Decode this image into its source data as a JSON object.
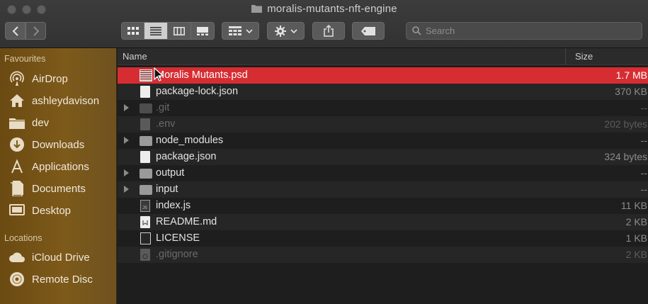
{
  "window": {
    "title": "moralis-mutants-nft-engine"
  },
  "toolbar": {
    "search_placeholder": "Search",
    "icons": [
      "chevron-left-icon",
      "chevron-right-icon",
      "icon-view-icon",
      "list-view-icon",
      "column-view-icon",
      "gallery-view-icon",
      "group-icon",
      "gear-icon",
      "share-icon",
      "tag-icon",
      "search-icon"
    ]
  },
  "sidebar": {
    "favourites_heading": "Favourites",
    "favourites": [
      {
        "label": "AirDrop",
        "icon": "airdrop-icon"
      },
      {
        "label": "ashleydavison",
        "icon": "home-icon"
      },
      {
        "label": "dev",
        "icon": "folder-icon"
      },
      {
        "label": "Downloads",
        "icon": "downloads-icon"
      },
      {
        "label": "Applications",
        "icon": "applications-icon"
      },
      {
        "label": "Documents",
        "icon": "documents-icon"
      },
      {
        "label": "Desktop",
        "icon": "desktop-icon"
      }
    ],
    "locations_heading": "Locations",
    "locations": [
      {
        "label": "iCloud Drive",
        "icon": "cloud-icon"
      },
      {
        "label": "Remote Disc",
        "icon": "disc-icon"
      }
    ]
  },
  "list": {
    "col_name": "Name",
    "col_size": "Size",
    "files": [
      {
        "name": "Moralis Mutants.psd",
        "size": "1.7 MB",
        "kind": "psd",
        "selected": true
      },
      {
        "name": "package-lock.json",
        "size": "370 KB",
        "kind": "doc"
      },
      {
        "name": ".git",
        "size": "--",
        "kind": "folder",
        "dim": true,
        "expand": true
      },
      {
        "name": ".env",
        "size": "202 bytes",
        "kind": "doc",
        "dim": true
      },
      {
        "name": "node_modules",
        "size": "--",
        "kind": "folder",
        "expand": true
      },
      {
        "name": "package.json",
        "size": "324 bytes",
        "kind": "doc"
      },
      {
        "name": "output",
        "size": "--",
        "kind": "folder",
        "expand": true
      },
      {
        "name": "input",
        "size": "--",
        "kind": "folder",
        "expand": true
      },
      {
        "name": "index.js",
        "size": "11 KB",
        "kind": "js"
      },
      {
        "name": "README.md",
        "size": "2 KB",
        "kind": "md"
      },
      {
        "name": "LICENSE",
        "size": "1 KB",
        "kind": "license"
      },
      {
        "name": ".gitignore",
        "size": "2 KB",
        "kind": "gear",
        "dim": true
      }
    ]
  }
}
